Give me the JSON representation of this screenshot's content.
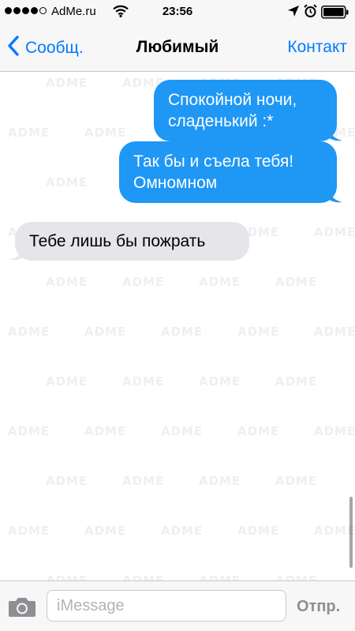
{
  "status_bar": {
    "carrier": "AdMe.ru",
    "time": "23:56",
    "signal_filled": 4,
    "signal_total": 5,
    "icons": [
      "wifi-icon",
      "location-arrow-icon",
      "alarm-clock-icon",
      "battery-icon"
    ]
  },
  "nav": {
    "back_label": "Сообщ.",
    "title": "Любимый",
    "contact_label": "Контакт"
  },
  "messages": [
    {
      "direction": "outgoing",
      "text": "Спокойной ночи, сладенький :*"
    },
    {
      "direction": "outgoing",
      "text": "Так бы и съела тебя! Омномном"
    },
    {
      "direction": "incoming",
      "text": "Тебе лишь бы пожрать"
    }
  ],
  "watermark": "ADME",
  "input_bar": {
    "placeholder": "iMessage",
    "value": "",
    "send_label": "Отпр."
  },
  "colors": {
    "accent": "#007aff",
    "outgoing_bubble": "#1f97f5",
    "incoming_bubble": "#e5e5ea",
    "bar_background": "#f7f7f8",
    "send_disabled": "#8e8e93"
  }
}
